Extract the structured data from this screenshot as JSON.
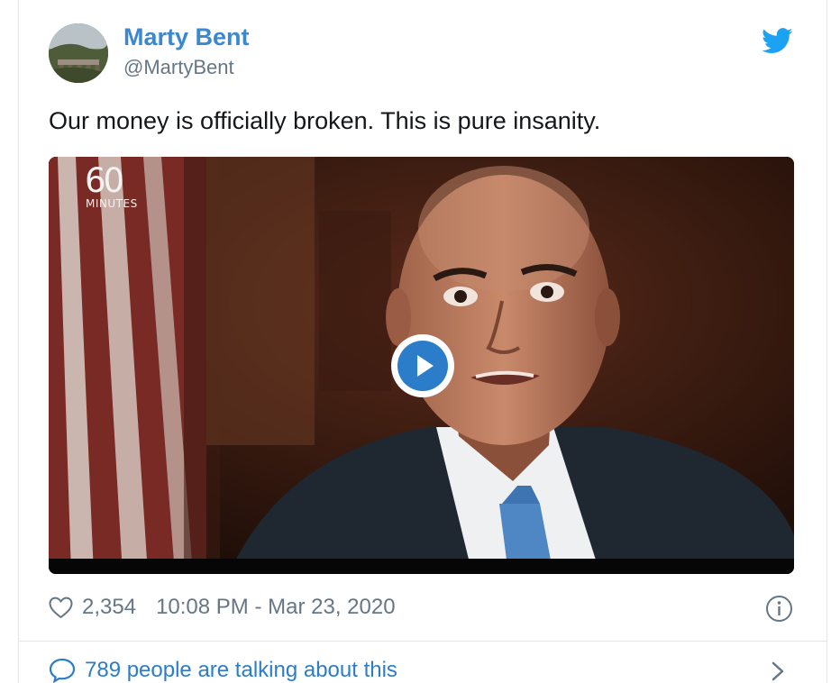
{
  "tweet": {
    "author": {
      "display_name": "Marty Bent",
      "handle": "@MartyBent"
    },
    "text": "Our money is officially broken. This is pure insanity.",
    "media": {
      "logo_number": "60",
      "logo_word": "MINUTES"
    },
    "likes": "2,354",
    "timestamp": "10:08 PM - Mar 23, 2020",
    "conversation_link": "789 people are talking about this"
  },
  "colors": {
    "accent": "#2c7dc9",
    "name": "#3a88d0",
    "muted": "#657786",
    "text": "#14171a"
  },
  "icons": {
    "brand": "twitter-bird-icon",
    "like": "heart-icon",
    "info": "info-icon",
    "reply": "speech-bubble-icon",
    "more": "chevron-right-icon",
    "play": "play-icon"
  }
}
